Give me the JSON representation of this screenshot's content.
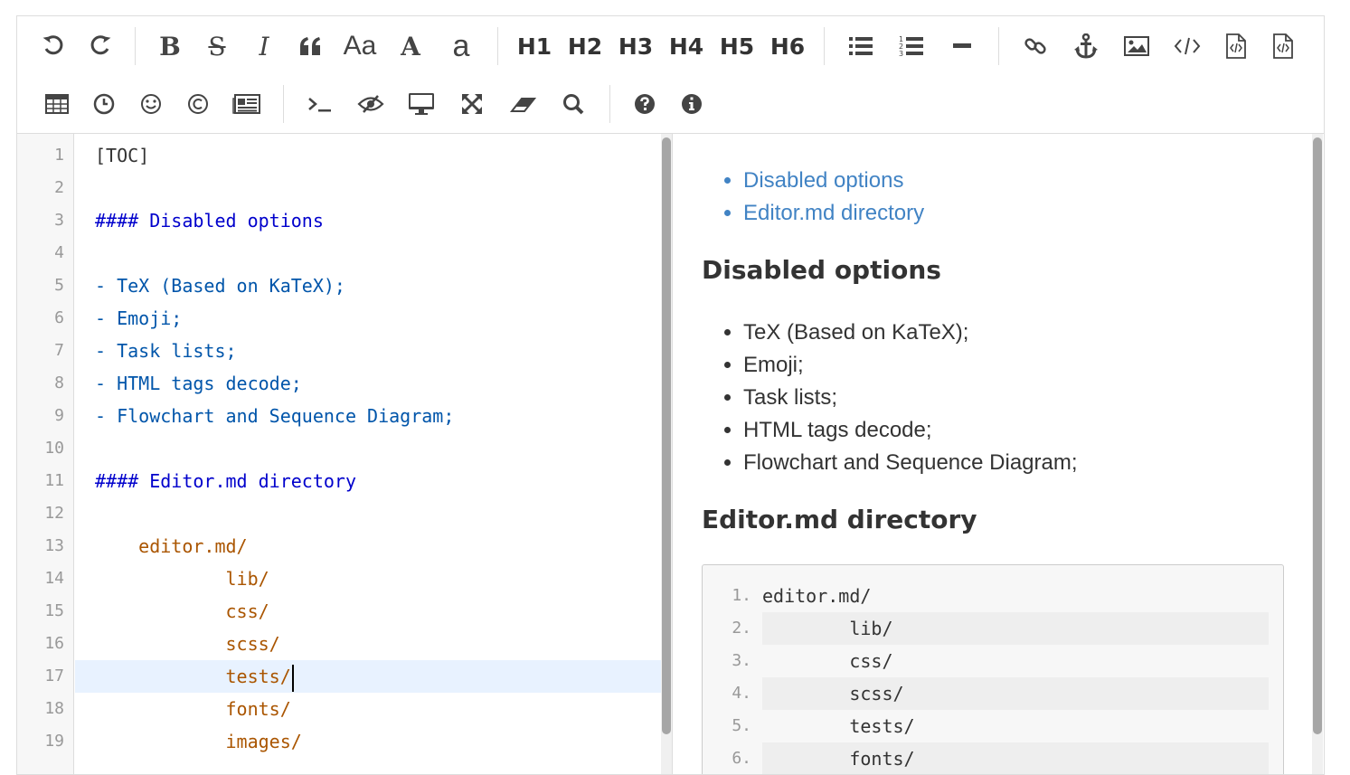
{
  "toolbar": {
    "heading_labels": [
      "H1",
      "H2",
      "H3",
      "H4",
      "H5",
      "H6"
    ],
    "font_size_label": "Aa",
    "uppercase_label": "A",
    "lowercase_label": "a",
    "bold_label": "B",
    "strikethrough_label": "S",
    "italic_label": "I"
  },
  "editor": {
    "lines": [
      {
        "num": "1",
        "text": "[TOC]"
      },
      {
        "num": "2",
        "text": ""
      },
      {
        "num": "3",
        "text": "#### Disabled options"
      },
      {
        "num": "4",
        "text": ""
      },
      {
        "num": "5",
        "text": "- TeX (Based on KaTeX);"
      },
      {
        "num": "6",
        "text": "- Emoji;"
      },
      {
        "num": "7",
        "text": "- Task lists;"
      },
      {
        "num": "8",
        "text": "- HTML tags decode;"
      },
      {
        "num": "9",
        "text": "- Flowchart and Sequence Diagram;"
      },
      {
        "num": "10",
        "text": ""
      },
      {
        "num": "11",
        "text": "#### Editor.md directory"
      },
      {
        "num": "12",
        "text": ""
      },
      {
        "num": "13",
        "text": "    editor.md/"
      },
      {
        "num": "14",
        "text": "            lib/"
      },
      {
        "num": "15",
        "text": "            css/"
      },
      {
        "num": "16",
        "text": "            scss/"
      },
      {
        "num": "17",
        "text": "            tests/"
      },
      {
        "num": "18",
        "text": "            fonts/"
      },
      {
        "num": "19",
        "text": "            images/"
      }
    ]
  },
  "preview": {
    "toc": [
      "Disabled options",
      "Editor.md directory"
    ],
    "section1_title": "Disabled options",
    "section1_items": [
      "TeX (Based on KaTeX);",
      "Emoji;",
      "Task lists;",
      "HTML tags decode;",
      "Flowchart and Sequence Diagram;"
    ],
    "section2_title": "Editor.md directory",
    "code_lines": [
      {
        "num": "1.",
        "text": "editor.md/"
      },
      {
        "num": "2.",
        "text": "        lib/"
      },
      {
        "num": "3.",
        "text": "        css/"
      },
      {
        "num": "4.",
        "text": "        scss/"
      },
      {
        "num": "5.",
        "text": "        tests/"
      },
      {
        "num": "6.",
        "text": "        fonts/"
      }
    ]
  }
}
